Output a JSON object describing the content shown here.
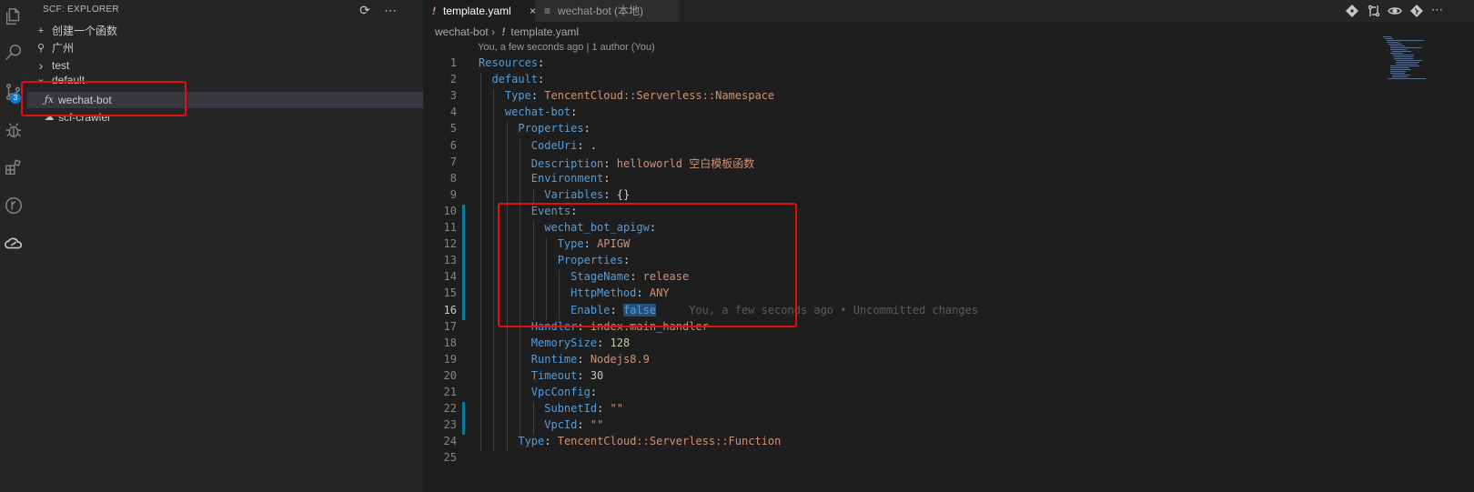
{
  "activity_bar": {
    "items": [
      {
        "icon": "files-icon"
      },
      {
        "icon": "search-icon"
      },
      {
        "icon": "source-control-icon",
        "badge": "3"
      },
      {
        "icon": "debug-icon"
      },
      {
        "icon": "extensions-icon"
      },
      {
        "icon": "gitlens-icon"
      },
      {
        "icon": "scf-cloud-icon"
      }
    ]
  },
  "sidebar": {
    "title": "SCF: EXPLORER",
    "tree": [
      {
        "glyph": "+",
        "label": "创建一个函数",
        "icon": "plus-icon"
      },
      {
        "glyph": "⚲",
        "label": "广州",
        "icon": "location-icon"
      },
      {
        "glyph": "›",
        "label": "test",
        "icon": "chevron-right-icon"
      },
      {
        "glyph": "⌄",
        "label": "default",
        "icon": "chevron-down-icon"
      },
      {
        "glyph": "ƒx",
        "label": "wechat-bot",
        "icon": "function-icon",
        "selected": true
      },
      {
        "glyph": "☁",
        "label": "scf-crawler",
        "icon": "cloud-icon"
      }
    ]
  },
  "tabs": [
    {
      "label": "template.yaml",
      "mark": "!",
      "active": true,
      "close": "×"
    },
    {
      "label": "wechat-bot (本地)",
      "mark": "≡",
      "active": false
    }
  ],
  "breadcrumb": {
    "folder": "wechat-bot",
    "separator": "›",
    "mark": "!",
    "file": "template.yaml"
  },
  "codelens": "You, a few seconds ago | 1 author (You)",
  "blame": "You, a few seconds ago • Uncommitted changes",
  "code": [
    {
      "n": "1",
      "indent": "",
      "key": "Resources",
      "sep": ":",
      "val": "",
      "vt": ""
    },
    {
      "n": "2",
      "indent": "  ",
      "key": "default",
      "sep": ":",
      "val": "",
      "vt": ""
    },
    {
      "n": "3",
      "indent": "    ",
      "key": "Type",
      "sep": ": ",
      "val": "TencentCloud::Serverless::Namespace",
      "vt": "s"
    },
    {
      "n": "4",
      "indent": "    ",
      "key": "wechat-bot",
      "sep": ":",
      "val": "",
      "vt": ""
    },
    {
      "n": "5",
      "indent": "      ",
      "key": "Properties",
      "sep": ":",
      "val": "",
      "vt": ""
    },
    {
      "n": "6",
      "indent": "        ",
      "key": "CodeUri",
      "sep": ": ",
      "val": ".",
      "vt": "p"
    },
    {
      "n": "7",
      "indent": "        ",
      "key": "Description",
      "sep": ": ",
      "val": "helloworld 空白模板函数",
      "vt": "s"
    },
    {
      "n": "8",
      "indent": "        ",
      "key": "Environment",
      "sep": ":",
      "val": "",
      "vt": ""
    },
    {
      "n": "9",
      "indent": "          ",
      "key": "Variables",
      "sep": ": ",
      "val": "{}",
      "vt": "p"
    },
    {
      "n": "10",
      "indent": "        ",
      "key": "Events",
      "sep": ":",
      "val": "",
      "vt": ""
    },
    {
      "n": "11",
      "indent": "          ",
      "key": "wechat_bot_apigw",
      "sep": ":",
      "val": "",
      "vt": ""
    },
    {
      "n": "12",
      "indent": "            ",
      "key": "Type",
      "sep": ": ",
      "val": "APIGW",
      "vt": "s"
    },
    {
      "n": "13",
      "indent": "            ",
      "key": "Properties",
      "sep": ":",
      "val": "",
      "vt": ""
    },
    {
      "n": "14",
      "indent": "              ",
      "key": "StageName",
      "sep": ": ",
      "val": "release",
      "vt": "s"
    },
    {
      "n": "15",
      "indent": "              ",
      "key": "HttpMethod",
      "sep": ": ",
      "val": "ANY",
      "vt": "s"
    },
    {
      "n": "16",
      "indent": "              ",
      "key": "Enable",
      "sep": ": ",
      "val": "false",
      "vt": "k",
      "current": true,
      "selected": true,
      "blame": true
    },
    {
      "n": "17",
      "indent": "        ",
      "key": "Handler",
      "sep": ": ",
      "val": "index.main_handler",
      "vt": "s"
    },
    {
      "n": "18",
      "indent": "        ",
      "key": "MemorySize",
      "sep": ": ",
      "val": "128",
      "vt": "n"
    },
    {
      "n": "19",
      "indent": "        ",
      "key": "Runtime",
      "sep": ": ",
      "val": "Nodejs8.9",
      "vt": "s"
    },
    {
      "n": "20",
      "indent": "        ",
      "key": "Timeout",
      "sep": ": ",
      "val": "30",
      "vt": "n"
    },
    {
      "n": "21",
      "indent": "        ",
      "key": "VpcConfig",
      "sep": ":",
      "val": "",
      "vt": ""
    },
    {
      "n": "22",
      "indent": "          ",
      "key": "SubnetId",
      "sep": ": ",
      "val": "\"\"",
      "vt": "s"
    },
    {
      "n": "23",
      "indent": "          ",
      "key": "VpcId",
      "sep": ": ",
      "val": "\"\"",
      "vt": "s"
    },
    {
      "n": "24",
      "indent": "      ",
      "key": "Type",
      "sep": ": ",
      "val": "TencentCloud::Serverless::Function",
      "vt": "s"
    },
    {
      "n": "25",
      "indent": "",
      "key": "",
      "sep": "",
      "val": "",
      "vt": ""
    }
  ],
  "colors": {
    "annotation_box": "#e01010",
    "key": "#569cd6",
    "string": "#ce9178",
    "number": "#b5cea8"
  }
}
